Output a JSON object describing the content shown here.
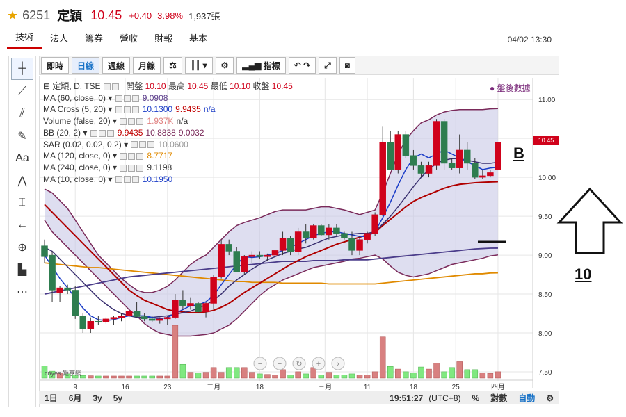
{
  "header": {
    "star_icon": "star-icon",
    "code": "6251",
    "name": "定穎",
    "price": "10.45",
    "change": "+0.40",
    "change_pct": "3.98%",
    "volume": "1,937張",
    "datetime": "04/02 13:30"
  },
  "tabs": [
    "技術",
    "法人",
    "籌券",
    "營收",
    "財報",
    "基本"
  ],
  "toolbar": {
    "buttons": [
      "即時",
      "日線",
      "週線",
      "月線"
    ],
    "indicators_label": "指標"
  },
  "legend": {
    "title": "定穎, D, TSE",
    "ohlc_text": "開盤 10.10 最高 10.45 最低 10.10 收盤 10.45",
    "open_label": "開盤",
    "open": "10.10",
    "high_label": "最高",
    "high": "10.45",
    "low_label": "最低",
    "low": "10.10",
    "close_label": "收盤",
    "close": "10.45",
    "rows": [
      {
        "label": "MA (60, close, 0)",
        "values": [
          "9.0908"
        ],
        "colors": [
          "#5a3c8a"
        ]
      },
      {
        "label": "MA Cross (5, 20)",
        "values": [
          "10.1300",
          "9.9435",
          "n/a"
        ],
        "colors": [
          "#1a3cc7",
          "#c00000",
          "#1a3cc7"
        ]
      },
      {
        "label": "Volume (false, 20)",
        "values": [
          "1.937K",
          "n/a"
        ],
        "colors": [
          "#e08080",
          "#333333"
        ]
      },
      {
        "label": "BB (20, 2)",
        "values": [
          "9.9435",
          "10.8838",
          "9.0032"
        ],
        "colors": [
          "#c00000",
          "#7a2a5a",
          "#7a2a5a"
        ]
      },
      {
        "label": "SAR (0.02, 0.02, 0.2)",
        "values": [
          "10.0600"
        ],
        "colors": [
          "#999999"
        ]
      },
      {
        "label": "MA (120, close, 0)",
        "values": [
          "8.7717"
        ],
        "colors": [
          "#e08a00"
        ]
      },
      {
        "label": "MA (240, close, 0)",
        "values": [
          "9.1198"
        ],
        "colors": [
          "#333333"
        ]
      },
      {
        "label": "MA (10, close, 0)",
        "values": [
          "10.1950"
        ],
        "colors": [
          "#1a3cc7"
        ]
      }
    ]
  },
  "after_hours": "盤後數據",
  "last_price_tag": "10.45",
  "logo_text": "cnyes 鉅亨網",
  "bottom": {
    "ranges": [
      "1日",
      "6月",
      "3y",
      "5y"
    ],
    "time": "19:51:27",
    "tz": "(UTC+8)",
    "pct": "%",
    "log": "對數",
    "auto": "自動"
  },
  "annotations": {
    "b_label": "B",
    "ten_label": "10"
  },
  "colors": {
    "up": "#d0021b",
    "down": "#2e7d4f",
    "band_fill": "#c8c8e6",
    "band_line": "#7a2a5a"
  },
  "chart_data": {
    "type": "candlestick",
    "y_ticks": [
      "11.00",
      "10.50",
      "10.00",
      "9.50",
      "9.00",
      "8.50",
      "8.00",
      "7.50"
    ],
    "ylim": [
      7.5,
      11.1
    ],
    "x_tick_labels": [
      "9",
      "16",
      "23",
      "二月",
      "18",
      "三月",
      "11",
      "18",
      "25",
      "四月"
    ],
    "candles": [
      [
        9.12,
        9.2,
        8.9,
        8.98
      ],
      [
        9.0,
        9.05,
        8.4,
        8.55
      ],
      [
        8.52,
        8.6,
        8.4,
        8.58
      ],
      [
        8.58,
        8.62,
        8.5,
        8.55
      ],
      [
        8.55,
        8.6,
        8.18,
        8.22
      ],
      [
        8.22,
        8.25,
        8.0,
        8.05
      ],
      [
        8.05,
        8.2,
        8.0,
        8.15
      ],
      [
        8.15,
        8.22,
        8.1,
        8.14
      ],
      [
        8.14,
        8.2,
        8.12,
        8.18
      ],
      [
        8.18,
        8.22,
        8.1,
        8.2
      ],
      [
        8.2,
        8.25,
        8.15,
        8.22
      ],
      [
        8.22,
        8.3,
        8.18,
        8.28
      ],
      [
        8.28,
        8.4,
        8.2,
        8.21
      ],
      [
        8.21,
        8.25,
        8.15,
        8.18
      ],
      [
        8.18,
        8.22,
        8.14,
        8.16
      ],
      [
        8.16,
        8.2,
        8.12,
        8.18
      ],
      [
        8.18,
        8.22,
        8.1,
        8.2
      ],
      [
        8.2,
        8.5,
        8.18,
        8.42
      ],
      [
        8.42,
        8.55,
        8.3,
        8.35
      ],
      [
        8.35,
        8.45,
        8.3,
        8.38
      ],
      [
        8.38,
        8.4,
        8.25,
        8.27
      ],
      [
        8.27,
        8.4,
        8.2,
        8.38
      ],
      [
        8.38,
        8.75,
        8.3,
        8.72
      ],
      [
        8.72,
        9.2,
        8.7,
        9.14
      ],
      [
        9.14,
        9.2,
        9.0,
        9.05
      ],
      [
        9.05,
        9.1,
        8.9,
        8.78
      ],
      [
        8.78,
        9.0,
        8.75,
        8.98
      ],
      [
        8.98,
        9.05,
        8.9,
        9.0
      ],
      [
        9.0,
        9.05,
        8.95,
        8.98
      ],
      [
        8.98,
        9.02,
        8.93,
        9.0
      ],
      [
        9.0,
        9.1,
        8.95,
        9.06
      ],
      [
        9.06,
        9.3,
        9.0,
        9.22
      ],
      [
        9.22,
        9.25,
        9.0,
        9.04
      ],
      [
        9.04,
        9.35,
        9.0,
        9.3
      ],
      [
        9.3,
        9.4,
        9.15,
        9.22
      ],
      [
        9.22,
        9.4,
        9.2,
        9.38
      ],
      [
        9.38,
        9.4,
        9.25,
        9.26
      ],
      [
        9.26,
        9.4,
        9.2,
        9.35
      ],
      [
        9.35,
        9.4,
        9.25,
        9.28
      ],
      [
        9.28,
        9.3,
        9.2,
        9.22
      ],
      [
        9.22,
        9.3,
        9.0,
        9.06
      ],
      [
        9.06,
        9.25,
        9.0,
        9.2
      ],
      [
        9.2,
        9.3,
        9.15,
        9.28
      ],
      [
        9.28,
        9.55,
        9.25,
        9.52
      ],
      [
        9.52,
        10.65,
        9.5,
        10.45
      ],
      [
        10.45,
        10.6,
        10.3,
        10.1
      ],
      [
        10.1,
        10.6,
        10.05,
        10.55
      ],
      [
        10.55,
        10.6,
        10.25,
        10.28
      ],
      [
        10.28,
        10.35,
        10.1,
        10.15
      ],
      [
        10.15,
        10.2,
        10.0,
        10.05
      ],
      [
        10.05,
        10.2,
        10.0,
        10.15
      ],
      [
        10.15,
        10.75,
        10.1,
        10.72
      ],
      [
        10.72,
        10.75,
        10.1,
        10.18
      ],
      [
        10.18,
        10.25,
        10.1,
        10.12
      ],
      [
        10.12,
        10.55,
        10.05,
        10.35
      ],
      [
        10.35,
        10.45,
        10.1,
        10.18
      ],
      [
        10.18,
        10.25,
        9.98,
        10.0
      ],
      [
        10.0,
        10.1,
        9.98,
        10.02
      ],
      [
        10.02,
        10.1,
        10.0,
        10.06
      ],
      [
        10.1,
        10.45,
        10.1,
        10.45
      ]
    ],
    "volumes": [
      230,
      130,
      100,
      80,
      60,
      50,
      45,
      40,
      40,
      40,
      40,
      40,
      40,
      40,
      40,
      40,
      40,
      1000,
      260,
      110,
      100,
      110,
      200,
      110,
      200,
      200,
      200,
      110,
      80,
      70,
      60,
      160,
      60,
      120,
      80,
      200,
      60,
      110,
      60,
      60,
      80,
      60,
      60,
      120,
      780,
      220,
      170,
      120,
      100,
      210,
      170,
      280,
      120,
      200,
      310,
      160,
      160,
      100,
      90,
      120
    ],
    "ma5": [
      9.0,
      8.85,
      8.7,
      8.58,
      8.45,
      8.32,
      8.22,
      8.17,
      8.16,
      8.17,
      8.2,
      8.22,
      8.22,
      8.22,
      8.2,
      8.18,
      8.2,
      8.25,
      8.3,
      8.35,
      8.36,
      8.4,
      8.48,
      8.62,
      8.75,
      8.88,
      8.98,
      8.97,
      8.98,
      9.0,
      9.02,
      9.06,
      9.1,
      9.15,
      9.2,
      9.25,
      9.28,
      9.3,
      9.3,
      9.28,
      9.26,
      9.24,
      9.24,
      9.3,
      9.48,
      9.68,
      9.9,
      10.1,
      10.25,
      10.3,
      10.25,
      10.3,
      10.35,
      10.3,
      10.25,
      10.2,
      10.15,
      10.1,
      10.12,
      10.13
    ],
    "ma10": [
      9.1,
      9.05,
      8.95,
      8.85,
      8.75,
      8.65,
      8.55,
      8.45,
      8.37,
      8.3,
      8.25,
      8.22,
      8.2,
      8.2,
      8.2,
      8.21,
      8.22,
      8.24,
      8.26,
      8.28,
      8.32,
      8.36,
      8.42,
      8.5,
      8.6,
      8.68,
      8.75,
      8.82,
      8.88,
      8.94,
      8.98,
      9.02,
      9.05,
      9.08,
      9.1,
      9.14,
      9.18,
      9.22,
      9.24,
      9.26,
      9.27,
      9.28,
      9.28,
      9.3,
      9.4,
      9.5,
      9.62,
      9.75,
      9.88,
      10.0,
      10.1,
      10.18,
      10.22,
      10.24,
      10.24,
      10.22,
      10.2,
      10.18,
      10.18,
      10.195
    ],
    "ma20": [
      9.65,
      9.55,
      9.45,
      9.35,
      9.25,
      9.15,
      9.05,
      8.95,
      8.85,
      8.75,
      8.65,
      8.55,
      8.48,
      8.42,
      8.38,
      8.34,
      8.3,
      8.28,
      8.27,
      8.26,
      8.26,
      8.27,
      8.29,
      8.33,
      8.38,
      8.45,
      8.52,
      8.58,
      8.64,
      8.7,
      8.76,
      8.82,
      8.88,
      8.93,
      8.98,
      9.02,
      9.06,
      9.1,
      9.14,
      9.17,
      9.2,
      9.23,
      9.26,
      9.29,
      9.38,
      9.46,
      9.54,
      9.62,
      9.69,
      9.74,
      9.78,
      9.82,
      9.86,
      9.89,
      9.91,
      9.92,
      9.93,
      9.935,
      9.94,
      9.9435
    ],
    "ma60": [
      8.5,
      8.52,
      8.54,
      8.56,
      8.58,
      8.6,
      8.62,
      8.64,
      8.66,
      8.68,
      8.7,
      8.72,
      8.73,
      8.74,
      8.75,
      8.76,
      8.77,
      8.78,
      8.79,
      8.8,
      8.81,
      8.82,
      8.83,
      8.84,
      8.85,
      8.86,
      8.87,
      8.88,
      8.89,
      8.9,
      8.91,
      8.92,
      8.92,
      8.92,
      8.92,
      8.93,
      8.93,
      8.93,
      8.93,
      8.94,
      8.94,
      8.94,
      8.94,
      8.95,
      8.96,
      8.97,
      8.98,
      8.99,
      9.0,
      9.01,
      9.02,
      9.03,
      9.04,
      9.05,
      9.06,
      9.07,
      9.08,
      9.085,
      9.09,
      9.0908
    ],
    "ma120": [
      8.9,
      8.89,
      8.88,
      8.87,
      8.86,
      8.85,
      8.84,
      8.84,
      8.83,
      8.82,
      8.81,
      8.8,
      8.79,
      8.78,
      8.77,
      8.76,
      8.75,
      8.74,
      8.73,
      8.72,
      8.71,
      8.7,
      8.69,
      8.68,
      8.67,
      8.66,
      8.66,
      8.65,
      8.65,
      8.65,
      8.65,
      8.64,
      8.64,
      8.64,
      8.64,
      8.64,
      8.64,
      8.63,
      8.63,
      8.63,
      8.63,
      8.63,
      8.63,
      8.63,
      8.64,
      8.65,
      8.66,
      8.67,
      8.68,
      8.69,
      8.7,
      8.71,
      8.72,
      8.73,
      8.74,
      8.75,
      8.76,
      8.76,
      8.77,
      8.7717
    ],
    "bb_upper": [
      9.85,
      9.8,
      9.7,
      9.6,
      9.45,
      9.3,
      9.15,
      9.0,
      8.9,
      8.8,
      8.7,
      8.62,
      8.55,
      8.52,
      8.52,
      8.55,
      8.6,
      8.68,
      8.78,
      8.88,
      8.95,
      9.0,
      9.1,
      9.2,
      9.3,
      9.38,
      9.42,
      9.45,
      9.48,
      9.52,
      9.56,
      9.58,
      9.58,
      9.58,
      9.58,
      9.6,
      9.62,
      9.62,
      9.6,
      9.58,
      9.55,
      9.52,
      9.55,
      9.58,
      9.8,
      10.05,
      10.3,
      10.48,
      10.6,
      10.7,
      10.74,
      10.8,
      10.84,
      10.86,
      10.87,
      10.87,
      10.87,
      10.87,
      10.88,
      10.8838
    ],
    "bb_lower": [
      9.45,
      9.3,
      9.2,
      9.1,
      9.0,
      8.9,
      8.8,
      8.7,
      8.6,
      8.5,
      8.4,
      8.3,
      8.22,
      8.12,
      8.05,
      8.0,
      7.98,
      7.96,
      7.96,
      7.96,
      7.97,
      7.98,
      8.0,
      8.05,
      8.1,
      8.18,
      8.28,
      8.38,
      8.48,
      8.56,
      8.62,
      8.68,
      8.72,
      8.76,
      8.8,
      8.84,
      8.86,
      8.88,
      8.9,
      8.92,
      8.95,
      8.96,
      8.98,
      9.0,
      8.95,
      8.86,
      8.78,
      8.74,
      8.72,
      8.74,
      8.76,
      8.8,
      8.84,
      8.88,
      8.9,
      8.92,
      8.94,
      8.96,
      8.99,
      9.0032
    ]
  }
}
